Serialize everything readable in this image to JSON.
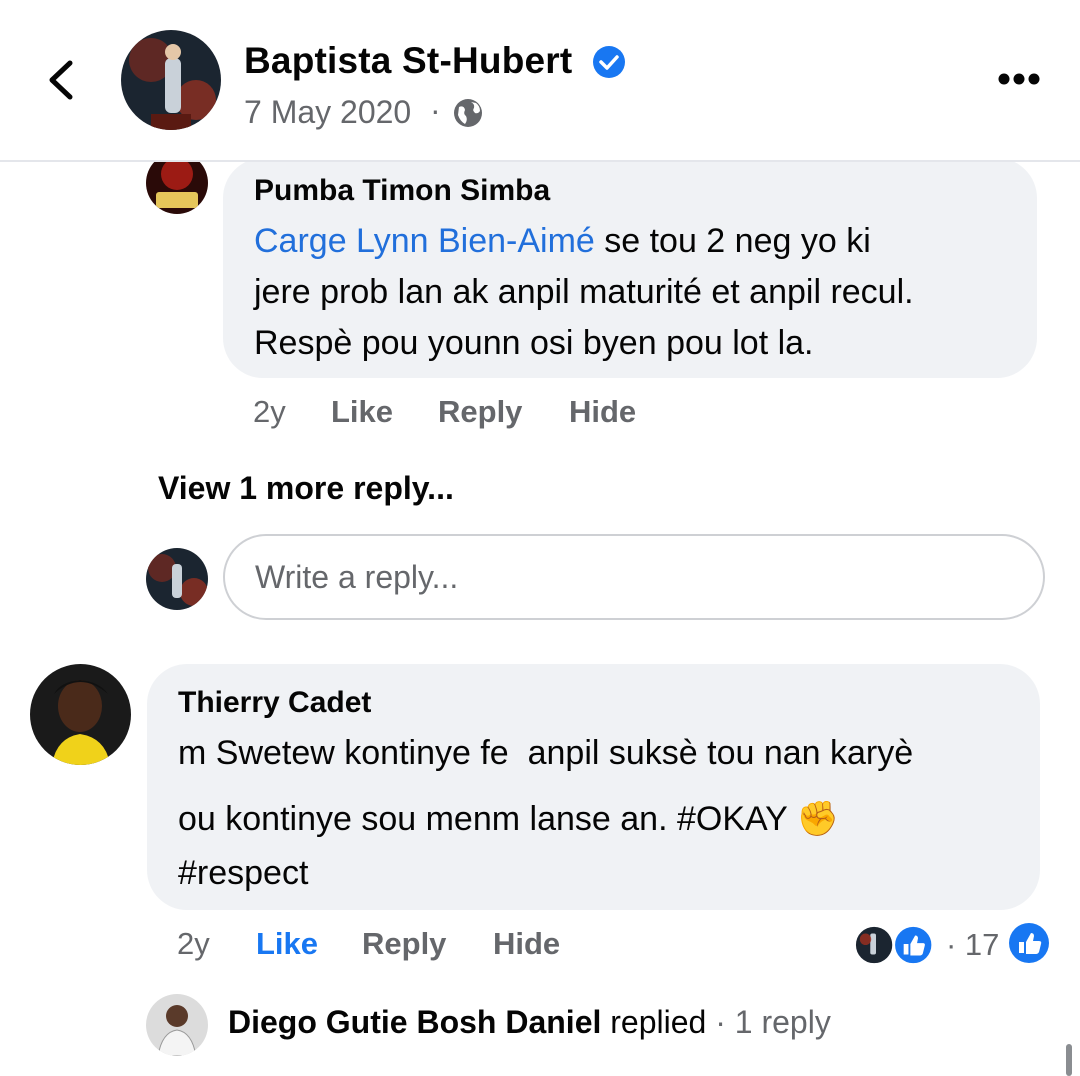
{
  "header": {
    "author": "Baptista St-Hubert",
    "date": "7 May 2020",
    "separator": "·",
    "icons": [
      "back-icon",
      "verified-icon",
      "globe-icon",
      "more-icon"
    ]
  },
  "comments": [
    {
      "author": "Pumba Timon Simba",
      "mention": "Carge Lynn Bien-Aimé",
      "line1_rest": " se tou 2 neg yo ki",
      "line2": "jere prob lan ak anpil maturité et anpil recul.",
      "line3": "Respè pou younn osi byen pou lot la.",
      "time": "2y",
      "like": "Like",
      "reply": "Reply",
      "hide": "Hide"
    },
    {
      "author": "Thierry Cadet",
      "line1": "m Swetew kontinye fe  anpil suksè tou nan karyè",
      "line2": "ou kontinye sou menm lanse an. #OKAY",
      "emoji": "✊",
      "line3": "#respect",
      "time": "2y",
      "like": "Like",
      "reply": "Reply",
      "hide": "Hide",
      "reaction_count": "· 17",
      "liked": true
    }
  ],
  "view_more": "View 1 more reply...",
  "reply_box": {
    "placeholder": "Write a reply..."
  },
  "replied_summary": {
    "name": "Diego Gutie Bosh Daniel",
    "verb": " replied",
    "count": " · 1 reply"
  },
  "colors": {
    "link": "#216fdb",
    "like_blue": "#1877f2",
    "bubble": "#f0f2f5",
    "muted": "#65676b"
  }
}
